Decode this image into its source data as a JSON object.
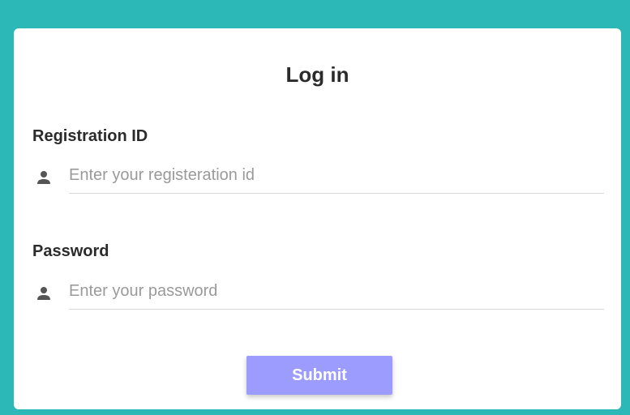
{
  "colors": {
    "background": "#2bb8b6",
    "card": "#ffffff",
    "submit_button": "#9c9cff",
    "icon": "#555555"
  },
  "login": {
    "title": "Log in",
    "registration": {
      "label": "Registration ID",
      "placeholder": "Enter your registeration id",
      "icon": "person-icon"
    },
    "password": {
      "label": "Password",
      "placeholder": "Enter your password",
      "icon": "person-icon"
    },
    "submit_label": "Submit"
  }
}
